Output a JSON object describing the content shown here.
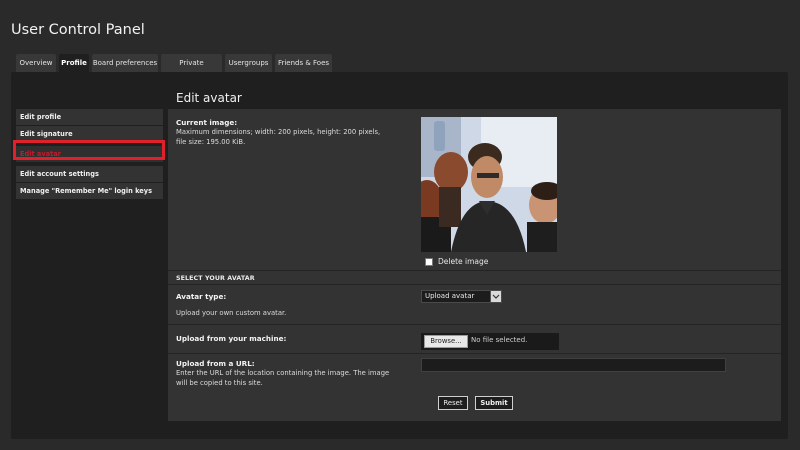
{
  "panel": {
    "title": "User Control Panel"
  },
  "tabs": [
    {
      "label": "Overview",
      "active": false
    },
    {
      "label": "Profile",
      "active": true
    },
    {
      "label": "Board preferences",
      "active": false
    },
    {
      "label": "Private messages",
      "active": false
    },
    {
      "label": "Usergroups",
      "active": false
    },
    {
      "label": "Friends & Foes",
      "active": false
    }
  ],
  "sidebar": {
    "items": [
      {
        "label": "Edit profile",
        "active": false
      },
      {
        "label": "Edit signature",
        "active": false
      },
      {
        "label": "Edit avatar",
        "active": true
      },
      {
        "label": "Edit account settings",
        "active": false
      },
      {
        "label": "Manage \"Remember Me\" login keys",
        "active": false
      }
    ]
  },
  "main": {
    "title": "Edit avatar",
    "current_image": {
      "label": "Current image:",
      "description_line1": "Maximum dimensions; width: 200 pixels, height: 200 pixels,",
      "description_line2": "file size: 195.00 KiB."
    },
    "delete_image_label": "Delete image",
    "section_heading": "SELECT YOUR AVATAR",
    "avatar_type": {
      "label": "Avatar type:",
      "help": "Upload your own custom avatar.",
      "selected": "Upload avatar"
    },
    "upload_machine": {
      "label": "Upload from your machine:",
      "browse_label": "Browse...",
      "status": "No file selected."
    },
    "upload_url": {
      "label": "Upload from a URL:",
      "help_line1": "Enter the URL of the location containing the image. The image",
      "help_line2": "will be copied to this site.",
      "value": ""
    },
    "buttons": {
      "reset": "Reset",
      "submit": "Submit"
    }
  },
  "colors": {
    "background": "#2a2a2a",
    "panel": "#1f1f1f",
    "box": "#333333",
    "active_sidebar_text": "#c21c2c",
    "highlight": "#e0202a"
  }
}
